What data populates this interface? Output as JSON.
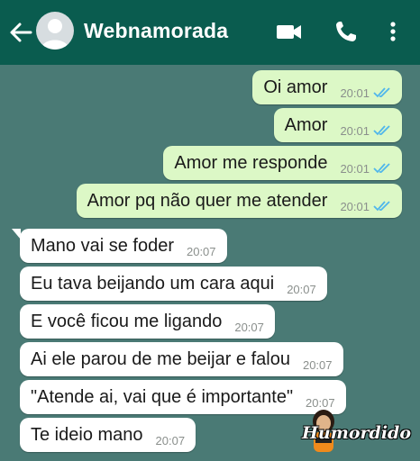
{
  "header": {
    "contact_name": "Webnamorada",
    "colors": {
      "bar": "#0a5c4f",
      "text": "#ffffff"
    },
    "icons": [
      "back-arrow-icon",
      "avatar-placeholder",
      "video-call-icon",
      "phone-icon",
      "more-vertical-icon"
    ]
  },
  "chat": {
    "background_color": "#4a7a75",
    "outgoing_color": "#dcf8c6",
    "incoming_color": "#ffffff",
    "tick_color": "#4fb6ec",
    "messages": [
      {
        "direction": "outgoing",
        "text": "Oi amor",
        "time": "20:01",
        "status": "read"
      },
      {
        "direction": "outgoing",
        "text": "Amor",
        "time": "20:01",
        "status": "read"
      },
      {
        "direction": "outgoing",
        "text": "Amor me responde",
        "time": "20:01",
        "status": "read"
      },
      {
        "direction": "outgoing",
        "text": "Amor pq não quer me atender",
        "time": "20:01",
        "status": "read"
      },
      {
        "direction": "incoming",
        "text": "Mano vai se foder",
        "time": "20:07"
      },
      {
        "direction": "incoming",
        "text": "Eu tava beijando um cara aqui",
        "time": "20:07"
      },
      {
        "direction": "incoming",
        "text": "E você ficou me ligando",
        "time": "20:07"
      },
      {
        "direction": "incoming",
        "text": "Ai ele parou de me beijar e falou",
        "time": "20:07"
      },
      {
        "direction": "incoming",
        "text": "\"Atende ai, vai que é importante\"",
        "time": "20:07"
      },
      {
        "direction": "incoming",
        "text": "Te ideio mano",
        "time": "20:07"
      }
    ]
  },
  "watermark": {
    "text": "Humordido"
  }
}
